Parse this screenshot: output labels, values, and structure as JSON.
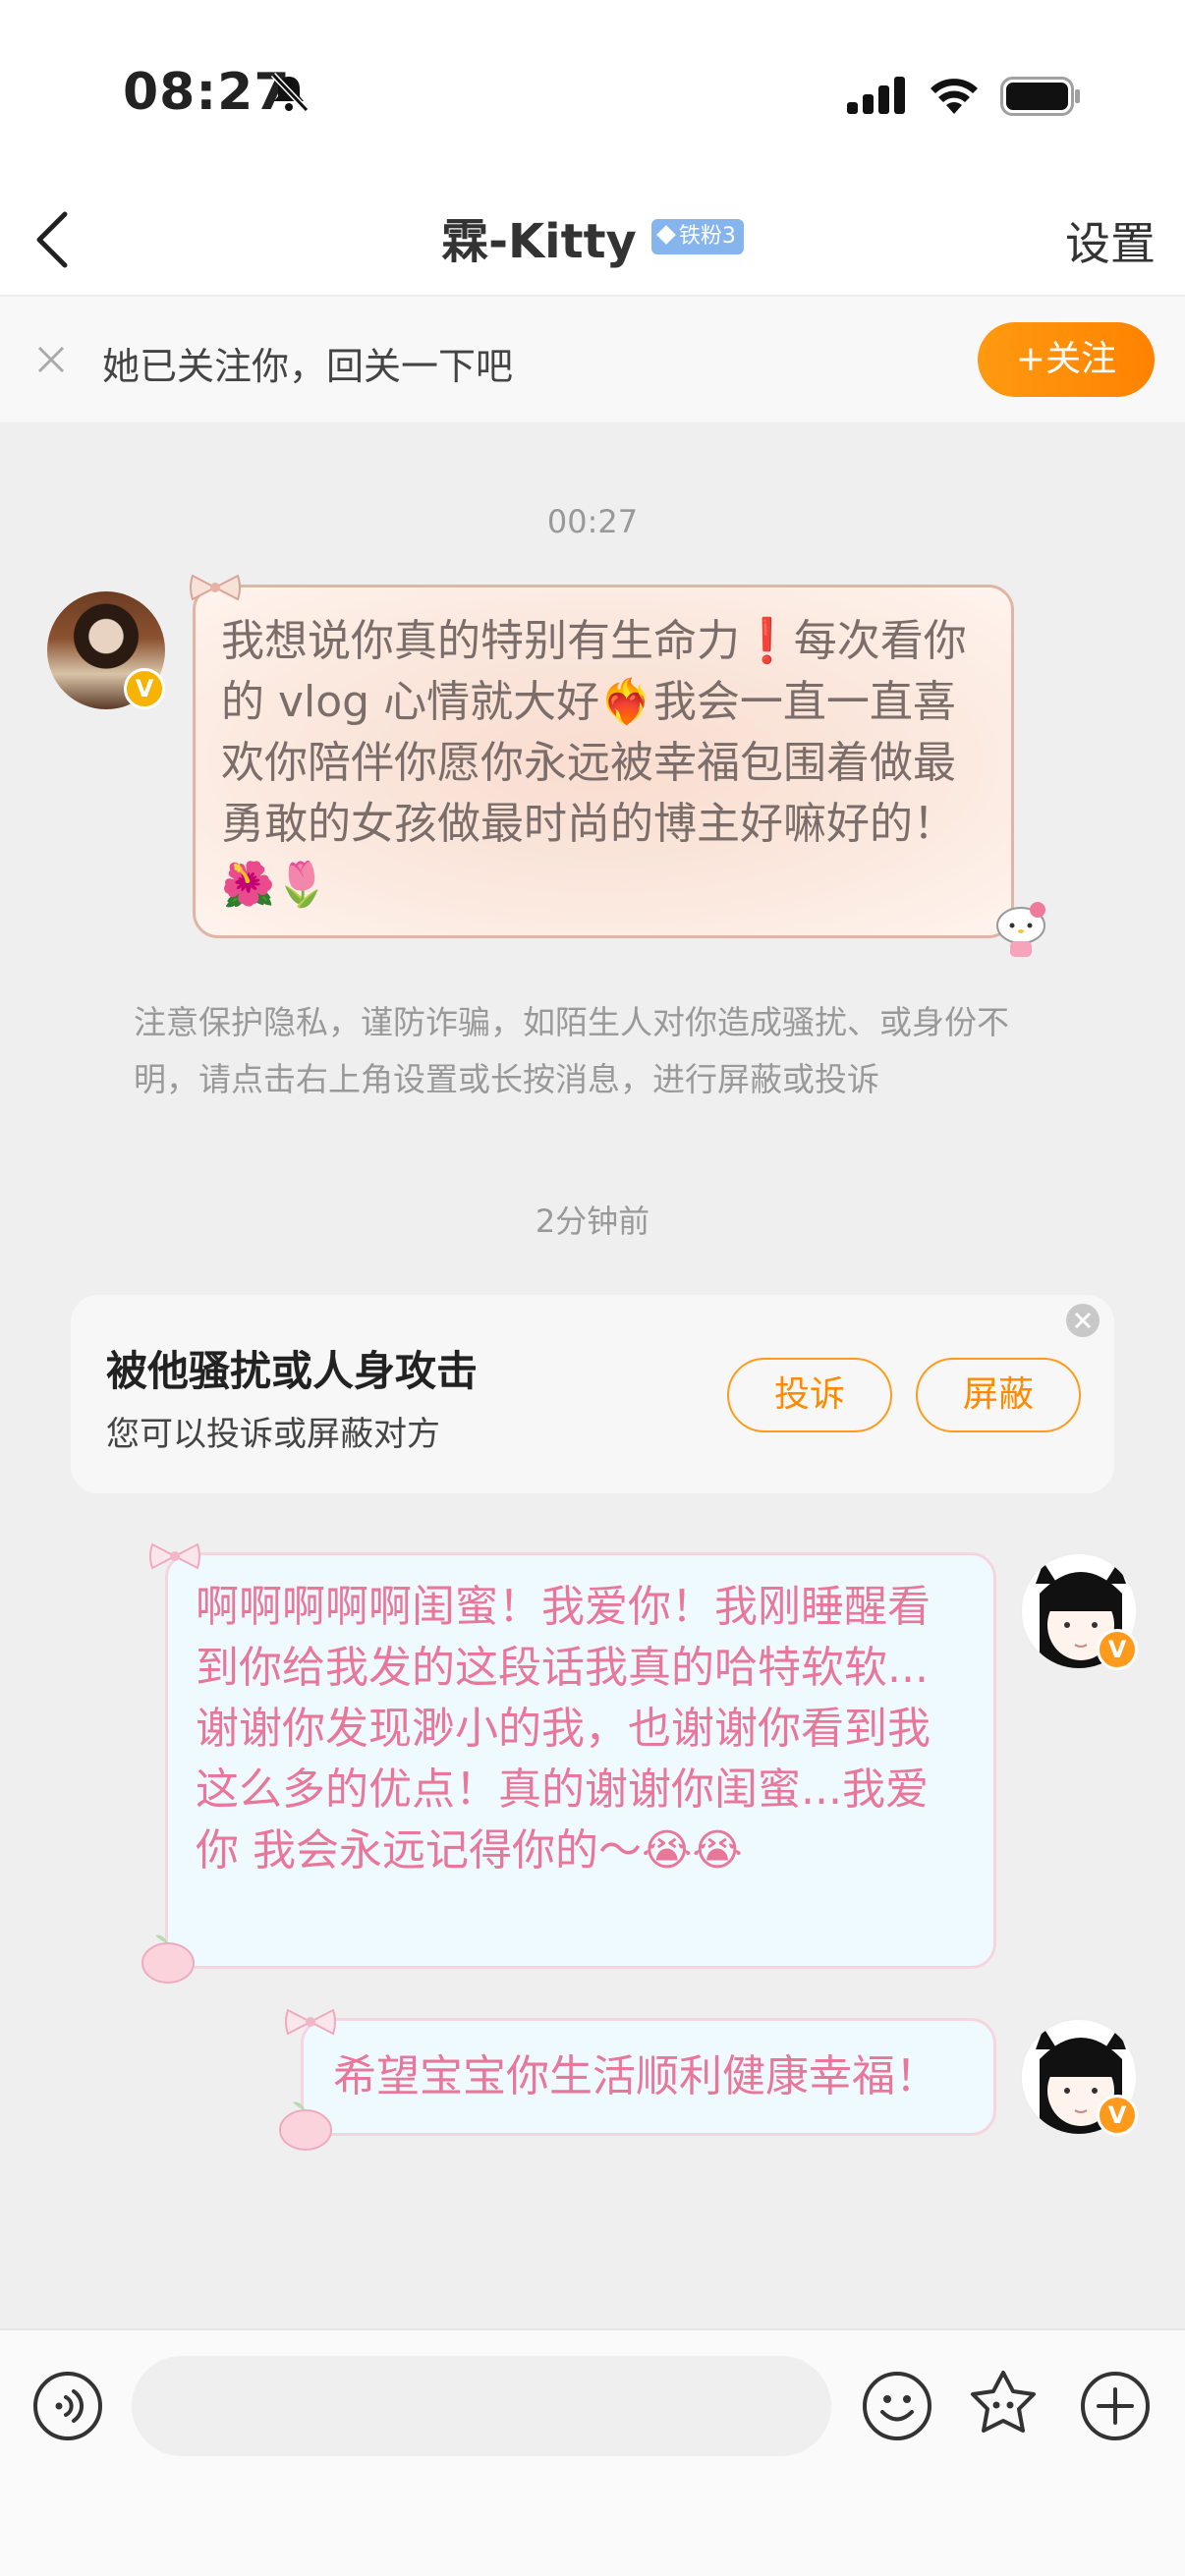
{
  "status_bar": {
    "time": "08:27"
  },
  "header": {
    "title": "霖-Kitty",
    "fan_badge": "铁粉3",
    "settings_label": "设置"
  },
  "follow_banner": {
    "text": "她已关注你，回关一下吧",
    "button_label": "+关注"
  },
  "chat": {
    "timestamp_1": "00:27",
    "incoming_message": "我想说你真的特别有生命力❗每次看你的 vlog 心情就大好❤️‍🔥我会一直一直喜欢你陪伴你愿你永远被幸福包围着做最勇敢的女孩做最时尚的博主好嘛好的！🌺🌷",
    "privacy_notice": "注意保护隐私，谨防诈骗，如陌生人对你造成骚扰、或身份不明，请点击右上角设置或长按消息，进行屏蔽或投诉",
    "timestamp_2": "2分钟前",
    "harassment_card": {
      "title": "被他骚扰或人身攻击",
      "subtitle": "您可以投诉或屏蔽对方",
      "report_label": "投诉",
      "block_label": "屏蔽"
    },
    "outgoing_message_1": "啊啊啊啊啊闺蜜！我爱你！我刚睡醒看到你给我发的这段话我真的哈特软软...谢谢你发现渺小的我，也谢谢你看到我这么多的优点！真的谢谢你闺蜜...我爱你 我会永远记得你的～😭😭",
    "outgoing_message_2": "希望宝宝你生活顺利健康幸福！"
  },
  "icons": {
    "status": [
      "bell-slash-icon",
      "signal-icon",
      "wifi-icon",
      "battery-icon"
    ],
    "input": [
      "voice-icon",
      "emoji-icon",
      "sticker-icon",
      "plus-icon"
    ]
  },
  "colors": {
    "accent_orange": "#ff8a00",
    "verified_badge": "#ff9a1d",
    "fan_badge": "#86b5ee",
    "incoming_text": "#7b6d6a",
    "outgoing_text": "#e8779a"
  }
}
